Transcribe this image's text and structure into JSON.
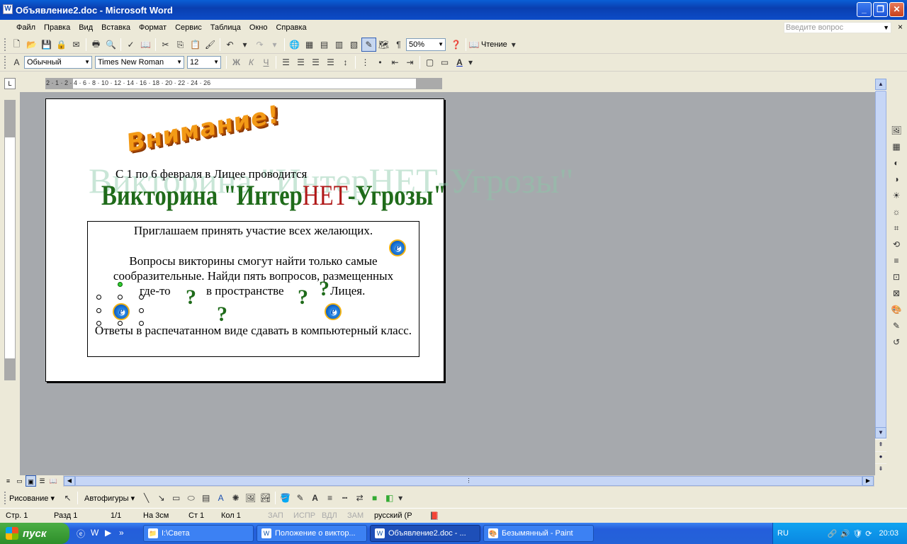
{
  "window": {
    "title": "Объявление2.doc - Microsoft Word"
  },
  "menu": {
    "items": [
      "Файл",
      "Правка",
      "Вид",
      "Вставка",
      "Формат",
      "Сервис",
      "Таблица",
      "Окно",
      "Справка"
    ],
    "help_placeholder": "Введите вопрос"
  },
  "toolbar": {
    "zoom": "50%",
    "reading_label": "Чтение",
    "style": "Обычный",
    "font": "Times New Roman",
    "size": "12"
  },
  "ruler": {
    "h_numbers": "2 · 1 · 2 · 4 · 6 · 8 · 10 · 12 · 14 · 16 · 18 · 20 · 22 · 24 · 26"
  },
  "document": {
    "wordart_heading": "Внимание!",
    "ghost_text": "Викторина \"ИнтерНЕТ-Угрозы\"",
    "date_line": "С 1 по 6 февраля  в Лицее проводится",
    "quiz_title_part1": "Викторина \"Интер",
    "quiz_title_part2": "НЕТ",
    "quiz_title_part3": "-Угрозы\"",
    "box_line1": "Приглашаем принять участие всех желающих.",
    "box_line2": "Вопросы викторины  смогут найти только самые",
    "box_line3": "сообразительные. Найди пять вопросов, размещенных",
    "box_line4a": "где-то",
    "box_line4b": "в пространстве",
    "box_line4c": "Лицея.",
    "box_line5": "Ответы в распечатанном виде сдавать в компьютерный класс.",
    "question_mark": "?"
  },
  "drawing_toolbar": {
    "draw_label": "Рисование ▾",
    "autoshapes_label": "Автофигуры ▾"
  },
  "status": {
    "page": "Стр. 1",
    "section": "Разд  1",
    "pages": "1/1",
    "at": "На  3см",
    "line": "Ст  1",
    "col": "Кол  1",
    "rec": "ЗАП",
    "trk": "ИСПР",
    "ext": "ВДЛ",
    "ovr": "ЗАМ",
    "language": "русский (Р"
  },
  "taskbar": {
    "start": "пуск",
    "tasks": [
      "I:\\Света",
      "Положение о виктор...",
      "Объявление2.doc - ...",
      "Безымянный - Paint"
    ],
    "lang": "RU",
    "clock": "20:03"
  }
}
